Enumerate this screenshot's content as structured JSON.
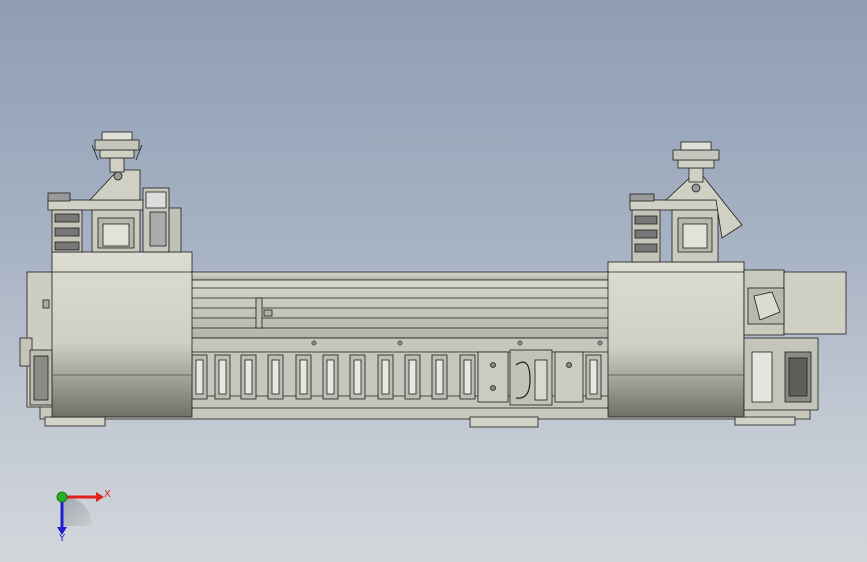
{
  "viewport": {
    "background_top": "#8f9db3",
    "background_bottom": "#d3d7dc",
    "part_fill": "#d2d2c8",
    "edge_color": "#1e1e1e"
  },
  "triad": {
    "x_label": "X",
    "y_label": "Y",
    "x_color": "#e01f1f",
    "y_color": "#1f1fd0",
    "origin_color": "#25b325"
  }
}
